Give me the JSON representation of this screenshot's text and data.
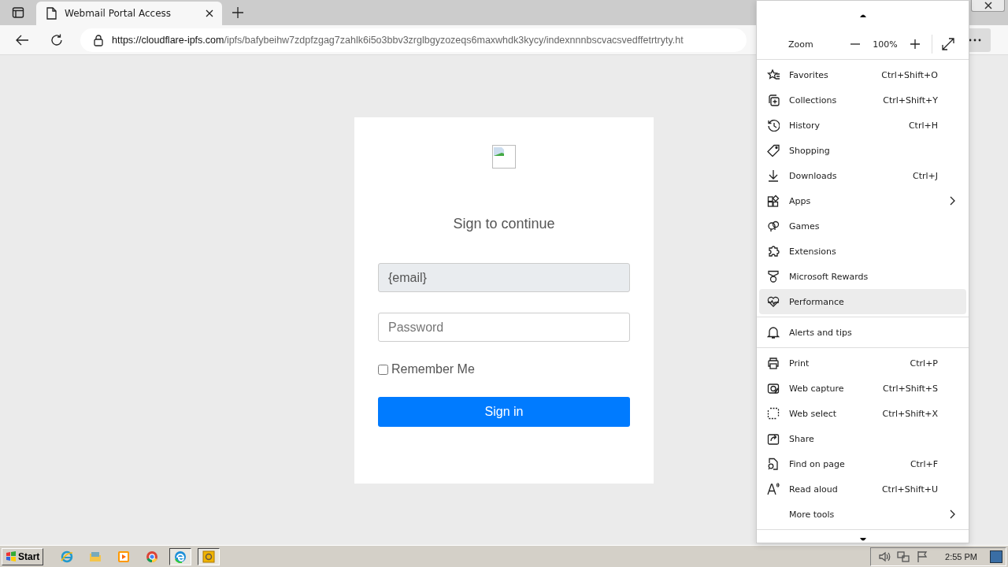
{
  "browser": {
    "tab": {
      "title": "Webmail Portal Access"
    },
    "address": {
      "host": "https://cloudflare-ipfs.com",
      "path": "/ipfs/bafybeihw7zdpfzgag7zahlk6i5o3bbv3zrglbgyzozeqs6maxwhdk3kycy/indexnnnbscvacsvedffetrtryty.ht"
    }
  },
  "login": {
    "heading": "Sign to continue",
    "email": {
      "value": "{email}",
      "readonly": true
    },
    "password": {
      "placeholder": "Password"
    },
    "remember": {
      "label": "Remember Me",
      "checked": false
    },
    "submit": "Sign in"
  },
  "menu": {
    "zoom": {
      "label": "Zoom",
      "value": "100%"
    },
    "groups": [
      [
        {
          "label": "Favorites",
          "shortcut": "Ctrl+Shift+O",
          "submenu": false,
          "highlighted": false
        },
        {
          "label": "Collections",
          "shortcut": "Ctrl+Shift+Y",
          "submenu": false,
          "highlighted": false
        },
        {
          "label": "History",
          "shortcut": "Ctrl+H",
          "submenu": false,
          "highlighted": false
        },
        {
          "label": "Shopping",
          "submenu": false,
          "highlighted": false
        },
        {
          "label": "Downloads",
          "shortcut": "Ctrl+J",
          "submenu": false,
          "highlighted": false
        },
        {
          "label": "Apps",
          "submenu": true,
          "highlighted": false
        },
        {
          "label": "Games",
          "submenu": false,
          "highlighted": false
        },
        {
          "label": "Extensions",
          "submenu": false,
          "highlighted": false
        },
        {
          "label": "Microsoft Rewards",
          "submenu": false,
          "highlighted": false
        },
        {
          "label": "Performance",
          "submenu": false,
          "highlighted": true
        }
      ],
      [
        {
          "label": "Alerts and tips",
          "submenu": false,
          "highlighted": false
        }
      ],
      [
        {
          "label": "Print",
          "shortcut": "Ctrl+P",
          "submenu": false,
          "highlighted": false
        },
        {
          "label": "Web capture",
          "shortcut": "Ctrl+Shift+S",
          "submenu": false,
          "highlighted": false
        },
        {
          "label": "Web select",
          "shortcut": "Ctrl+Shift+X",
          "submenu": false,
          "highlighted": false
        },
        {
          "label": "Share",
          "submenu": false,
          "highlighted": false
        },
        {
          "label": "Find on page",
          "shortcut": "Ctrl+F",
          "submenu": false,
          "highlighted": false
        },
        {
          "label": "Read aloud",
          "shortcut": "Ctrl+Shift+U",
          "submenu": false,
          "highlighted": false
        },
        {
          "label": "More tools",
          "submenu": true,
          "highlighted": false
        }
      ]
    ]
  },
  "taskbar": {
    "start": "Start",
    "apps": [
      {
        "pressed": false
      },
      {
        "pressed": false
      },
      {
        "pressed": false
      },
      {
        "pressed": false
      },
      {
        "pressed": true
      },
      {
        "pressed": true
      }
    ],
    "clock": "2:55 PM"
  }
}
